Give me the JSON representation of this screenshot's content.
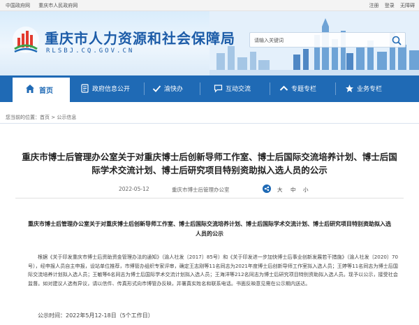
{
  "topbar": {
    "links_left": [
      "中国政府网",
      "重庆市人民政府网"
    ],
    "links_right": [
      "注册",
      "登录",
      "无障碍"
    ]
  },
  "header": {
    "site_title": "重庆市人力资源和社会保障局",
    "site_domain": "RLSBJ.CQ.GOV.CN",
    "search_placeholder": "请输入关键词"
  },
  "nav": {
    "items": [
      {
        "label": "首页",
        "icon": "home-icon",
        "active": true
      },
      {
        "label": "政府信息公开",
        "icon": "document-icon"
      },
      {
        "label": "渝快办",
        "icon": "service-icon"
      },
      {
        "label": "互动交流",
        "icon": "chat-icon"
      },
      {
        "label": "专题专栏",
        "icon": "topic-icon"
      },
      {
        "label": "业务专栏",
        "icon": "business-icon"
      }
    ]
  },
  "breadcrumb": {
    "label": "您当前的位置：",
    "path": [
      "首页",
      "公示信息"
    ],
    "text": "您当前的位置：首页 > 公示信息"
  },
  "article": {
    "title": "重庆市博士后管理办公室关于对重庆博士后创新导师工作室、博士后国际交流培养计划、博士后国际学术交流计划、博士后研究项目特别资助拟入选人员的公示",
    "date": "2022-05-12",
    "source": "重庆市博士后管理办公室",
    "font_sizes": [
      "大",
      "中",
      "小"
    ],
    "subtitle": "重庆市博士后管理办公室关于对重庆博士后创新导师工作室、博士后国际交流培养计划、博士后国际学术交流计划、博士后研究项目特别资助拟入选人员的公示",
    "body": "根据《关于印发重庆市博士后资助资金管理办法的通知》（渝人社发〔2017〕85号）和《关于印发进一步加快博士后事业创新发展若干措施》（渝人社发〔2020〕70号），经申报人员自主申报，设站单位推荐，市博管办组织专家评审，确定王志刚等11名同志为2021年度博士后创新导师工作室拟入选人员；王婷等11名同志为博士后国际交流培养计划拟入选人员；王敏等6名同志为博士后国际学术交流计划拟入选人员；王海洋等212名同志为博士后研究项目特别资助拟入选人员。现予以公示，接受社会监督。如对建议人选有异议，请以信件、传真形式向市博管办反映，并署真实姓名和联系电话。书面反映意见需在公示期内送达。",
    "publish_period": "公示时间：2022年5月12-18日（5个工作日）"
  },
  "colors": {
    "brand_blue": "#1f6ab5",
    "title_blue": "#1c5ca8"
  }
}
